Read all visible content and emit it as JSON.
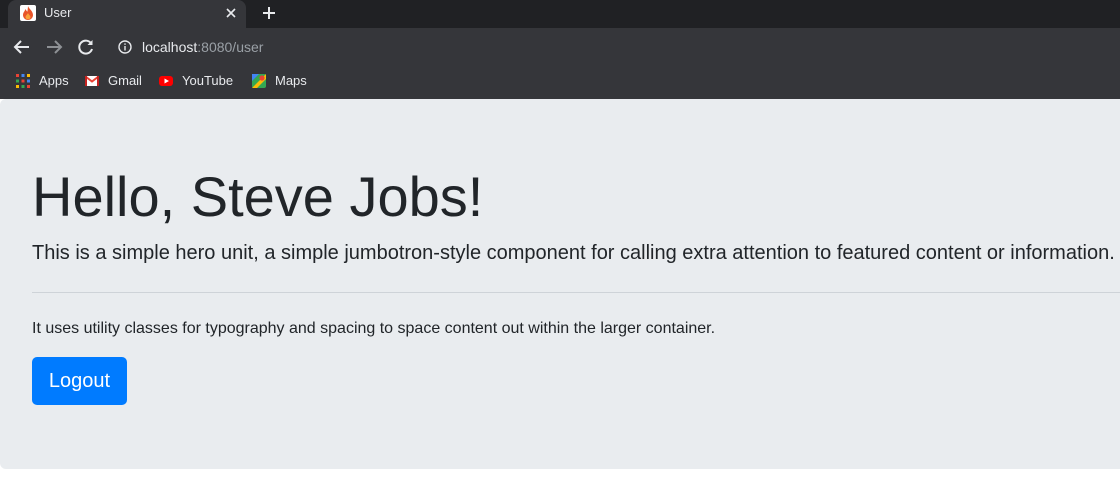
{
  "browser": {
    "tab": {
      "title": "User",
      "favicon": "flame-icon",
      "close_icon": "close-icon"
    },
    "new_tab_icon": "plus-icon",
    "nav": {
      "back_icon": "back-arrow-icon",
      "forward_icon": "forward-arrow-icon",
      "reload_icon": "reload-icon"
    },
    "address": {
      "host": "localhost",
      "rest": ":8080/user",
      "security_icon": "info-icon"
    },
    "bookmarks": [
      {
        "label": "Apps",
        "icon": "apps-grid-icon"
      },
      {
        "label": "Gmail",
        "icon": "gmail-icon"
      },
      {
        "label": "YouTube",
        "icon": "youtube-icon"
      },
      {
        "label": "Maps",
        "icon": "maps-icon"
      }
    ]
  },
  "page": {
    "heading": "Hello, Steve Jobs!",
    "lead": "This is a simple hero unit, a simple jumbotron-style component for calling extra attention to featured content or information.",
    "body": "It uses utility classes for typography and spacing to space content out within the larger container.",
    "logout_label": "Logout"
  },
  "colors": {
    "chrome_dark": "#202124",
    "chrome_toolbar": "#35363a",
    "jumbotron_bg": "#e9ecef",
    "primary": "#007bff",
    "text": "#212529"
  }
}
